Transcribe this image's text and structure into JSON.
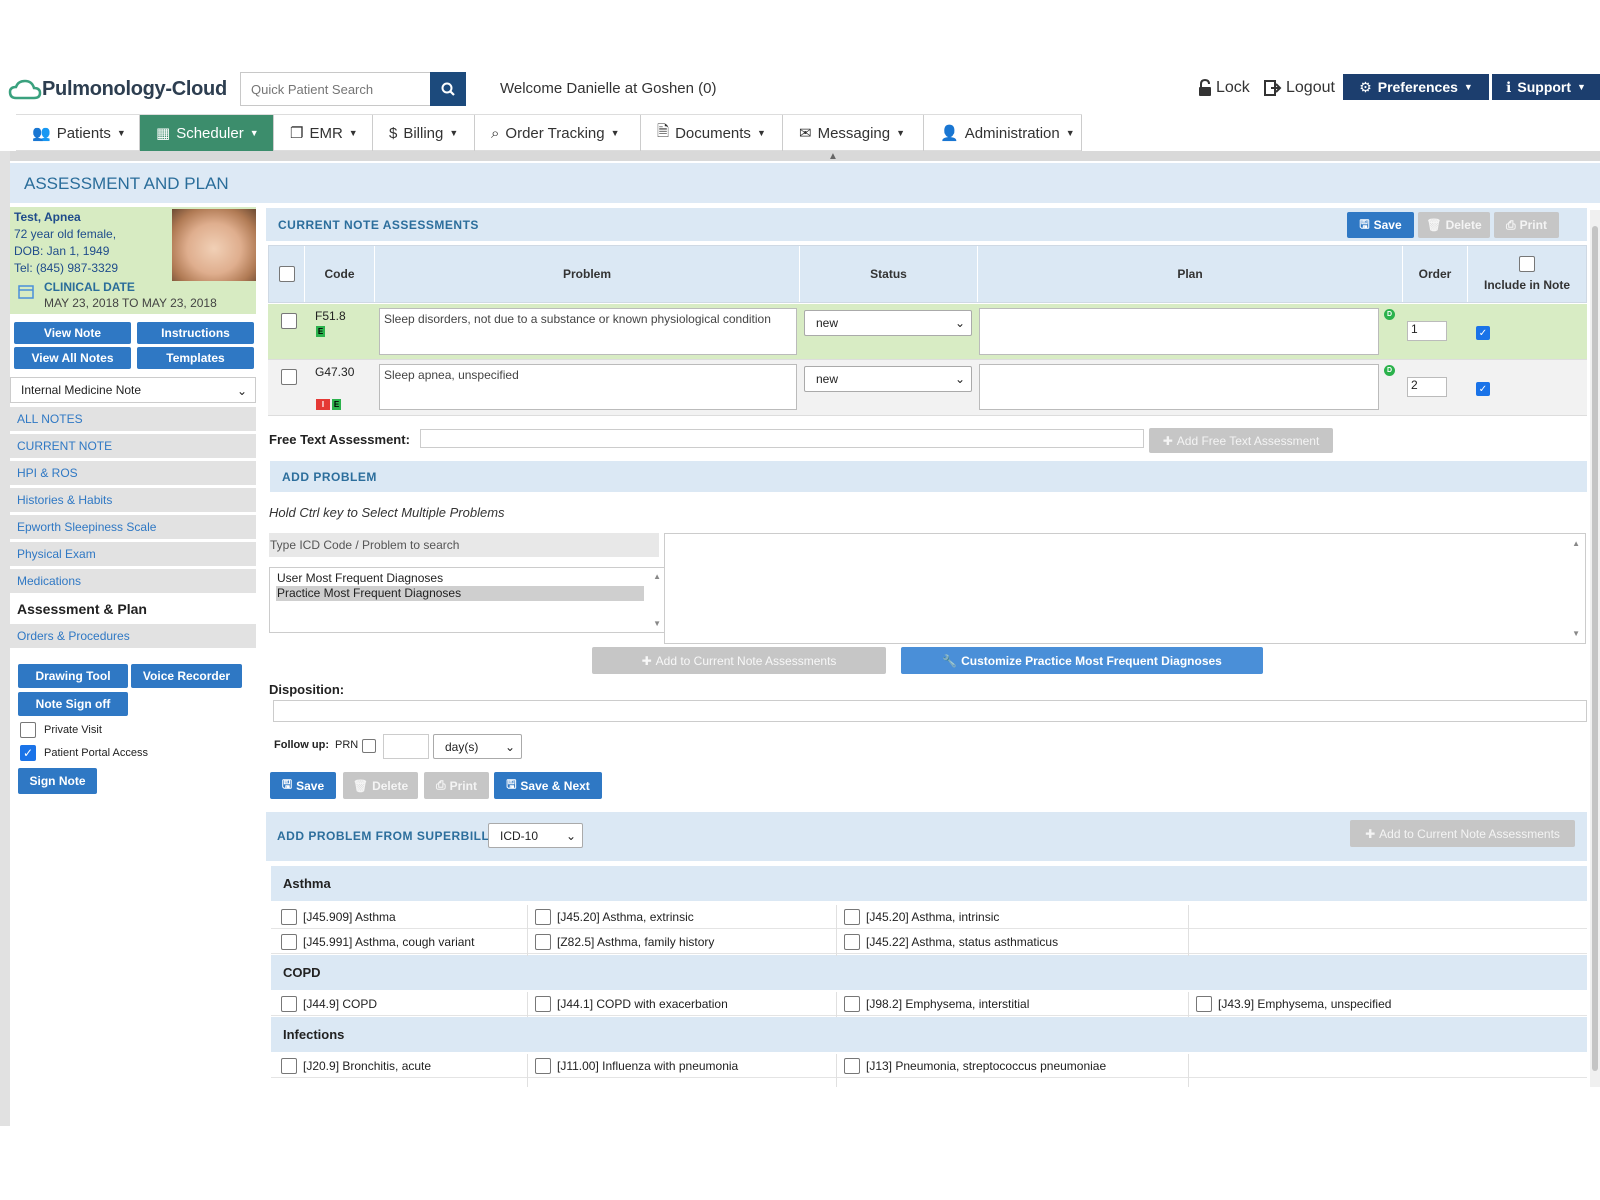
{
  "header": {
    "logo": "Pulmonology-Cloud",
    "search_placeholder": "Quick Patient Search",
    "welcome": "Welcome Danielle at Goshen (0)",
    "lock": "Lock",
    "logout": "Logout",
    "preferences": "Preferences",
    "support": "Support"
  },
  "nav": [
    {
      "label": "Patients",
      "icon": "users-icon"
    },
    {
      "label": "Scheduler",
      "icon": "calendar-icon"
    },
    {
      "label": "EMR",
      "icon": "copy-icon"
    },
    {
      "label": "Billing",
      "icon": "dollar-icon"
    },
    {
      "label": "Order Tracking",
      "icon": "search-icon"
    },
    {
      "label": "Documents",
      "icon": "file-icon"
    },
    {
      "label": "Messaging",
      "icon": "envelope-icon"
    },
    {
      "label": "Administration",
      "icon": "user-icon"
    }
  ],
  "page_title": "ASSESSMENT AND PLAN",
  "patient": {
    "name": "Test, Apnea",
    "age_sex": "72 year old female,",
    "dob": "DOB: Jan 1, 1949",
    "tel": "Tel: (845) 987-3329",
    "clinical_date_label": "CLINICAL DATE",
    "clinical_date": "MAY 23, 2018 TO MAY 23, 2018"
  },
  "left_buttons": {
    "view_note": "View Note",
    "instructions": "Instructions",
    "view_all_notes": "View All Notes",
    "templates": "Templates"
  },
  "note_type": "Internal Medicine Note",
  "sidebar": [
    "ALL NOTES",
    "CURRENT NOTE",
    "HPI & ROS",
    "Histories & Habits",
    "Epworth Sleepiness Scale",
    "Physical Exam",
    "Medications",
    "Assessment & Plan",
    "Orders & Procedures"
  ],
  "tools": {
    "drawing_tool": "Drawing Tool",
    "voice_recorder": "Voice Recorder",
    "note_sign_off": "Note Sign off",
    "private_visit": "Private Visit",
    "patient_portal_access": "Patient Portal Access",
    "sign_note": "Sign Note"
  },
  "assessments": {
    "title": "CURRENT NOTE ASSESSMENTS",
    "save": "Save",
    "delete": "Delete",
    "print": "Print",
    "columns": {
      "code": "Code",
      "problem": "Problem",
      "status": "Status",
      "plan": "Plan",
      "order": "Order",
      "include": "Include in Note"
    },
    "rows": [
      {
        "code": "F51.8",
        "problem": "Sleep disorders, not due to a substance or known physiological condition",
        "status": "new",
        "order": "1",
        "include": true
      },
      {
        "code": "G47.30",
        "problem": "Sleep apnea, unspecified",
        "status": "new",
        "order": "2",
        "include": true
      }
    ]
  },
  "free_text": {
    "label": "Free Text Assessment:",
    "button": "Add Free Text Assessment"
  },
  "add_problem": {
    "title": "ADD PROBLEM",
    "hint": "Hold Ctrl key to Select Multiple Problems",
    "search_placeholder": "Type ICD Code / Problem to search",
    "lists": [
      "User Most Frequent Diagnoses",
      "Practice Most Frequent Diagnoses"
    ],
    "add_button": "Add to Current Note Assessments",
    "customize_button": "Customize Practice Most Frequent Diagnoses"
  },
  "disposition": {
    "label": "Disposition:",
    "follow_up": "Follow up:",
    "prn": "PRN",
    "unit": "day(s)"
  },
  "bottom_buttons": {
    "save": "Save",
    "delete": "Delete",
    "print": "Print",
    "save_next": "Save & Next"
  },
  "superbill": {
    "title": "ADD PROBLEM FROM SUPERBILL",
    "code_set": "ICD-10",
    "add_button": "Add to Current Note Assessments",
    "categories": [
      {
        "name": "Asthma",
        "rows": [
          [
            "[J45.909] Asthma",
            "[J45.20] Asthma, extrinsic",
            "[J45.20] Asthma, intrinsic",
            ""
          ],
          [
            "[J45.991] Asthma, cough variant",
            "[Z82.5] Asthma, family history",
            "[J45.22] Asthma, status asthmaticus",
            ""
          ]
        ]
      },
      {
        "name": "COPD",
        "rows": [
          [
            "[J44.9] COPD",
            "[J44.1] COPD with exacerbation",
            "[J98.2] Emphysema, interstitial",
            "[J43.9] Emphysema, unspecified"
          ]
        ]
      },
      {
        "name": "Infections",
        "rows": [
          [
            "[J20.9] Bronchitis, acute",
            "[J11.00] Influenza with pneumonia",
            "[J13] Pneumonia, streptococcus pneumoniae",
            ""
          ]
        ]
      }
    ]
  }
}
